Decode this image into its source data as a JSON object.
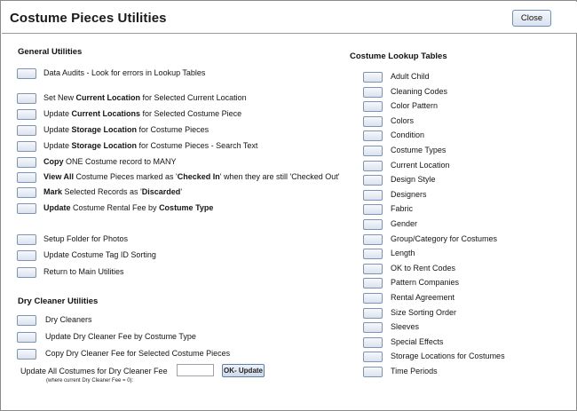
{
  "window": {
    "title": "Costume Pieces Utilities",
    "close_label": "Close"
  },
  "general": {
    "title": "General Utilities",
    "items": [
      {
        "pre": "Data Audits - Look for errors in Lookup Tables",
        "b1": "",
        "mid": "",
        "b2": "",
        "post": ""
      },
      {
        "pre": "Set New ",
        "b1": "Current Location",
        "mid": " for Selected Current Location",
        "b2": "",
        "post": ""
      },
      {
        "pre": "Update ",
        "b1": "Current Locations",
        "mid": " for Selected Costume Piece",
        "b2": "",
        "post": ""
      },
      {
        "pre": "Update ",
        "b1": "Storage Location",
        "mid": " for Costume Pieces",
        "b2": "",
        "post": ""
      },
      {
        "pre": "Update ",
        "b1": "Storage Location",
        "mid": " for Costume Pieces - Search Text",
        "b2": "",
        "post": ""
      },
      {
        "pre": "",
        "b1": "Copy",
        "mid": " ONE Costume record to MANY",
        "b2": "",
        "post": ""
      },
      {
        "pre": "",
        "b1": "View All",
        "mid": " Costume Pieces marked as '",
        "b2": "Checked In",
        "post": "' when they are still 'Checked Out'"
      },
      {
        "pre": "",
        "b1": "Mark",
        "mid": " Selected Records as '",
        "b2": "Discarded",
        "post": "'"
      },
      {
        "pre": "",
        "b1": "Update",
        "mid": " Costume Rental Fee by ",
        "b2": "Costume Type",
        "post": ""
      },
      {
        "pre": "Setup Folder for Photos",
        "b1": "",
        "mid": "",
        "b2": "",
        "post": ""
      },
      {
        "pre": "Update Costume Tag ID Sorting",
        "b1": "",
        "mid": "",
        "b2": "",
        "post": ""
      },
      {
        "pre": "Return to Main Utilities",
        "b1": "",
        "mid": "",
        "b2": "",
        "post": ""
      }
    ]
  },
  "dry_cleaner": {
    "title": "Dry Cleaner Utilities",
    "items": [
      "Dry Cleaners",
      "Update Dry Cleaner Fee by Costume Type",
      "Copy Dry Cleaner Fee for Selected Costume Pieces"
    ],
    "fee_label": "Update All Costumes for Dry Cleaner Fee",
    "fee_note": "(where current Dry Cleaner Fee = 0):",
    "fee_value": "",
    "ok_label": "OK- Update"
  },
  "lookup": {
    "title": "Costume  Lookup Tables",
    "items": [
      "Adult Child",
      "Cleaning Codes",
      "Color Pattern",
      "Colors",
      "Condition",
      "Costume Types",
      "Current Location",
      "Design Style",
      "Designers",
      "Fabric",
      "Gender",
      "Group/Category for Costumes",
      "Length",
      "OK to Rent Codes",
      "Pattern Companies",
      "Rental Agreement",
      "Size Sorting Order",
      "Sleeves",
      "Special Effects",
      "Storage Locations for Costumes",
      "Time Periods"
    ]
  }
}
